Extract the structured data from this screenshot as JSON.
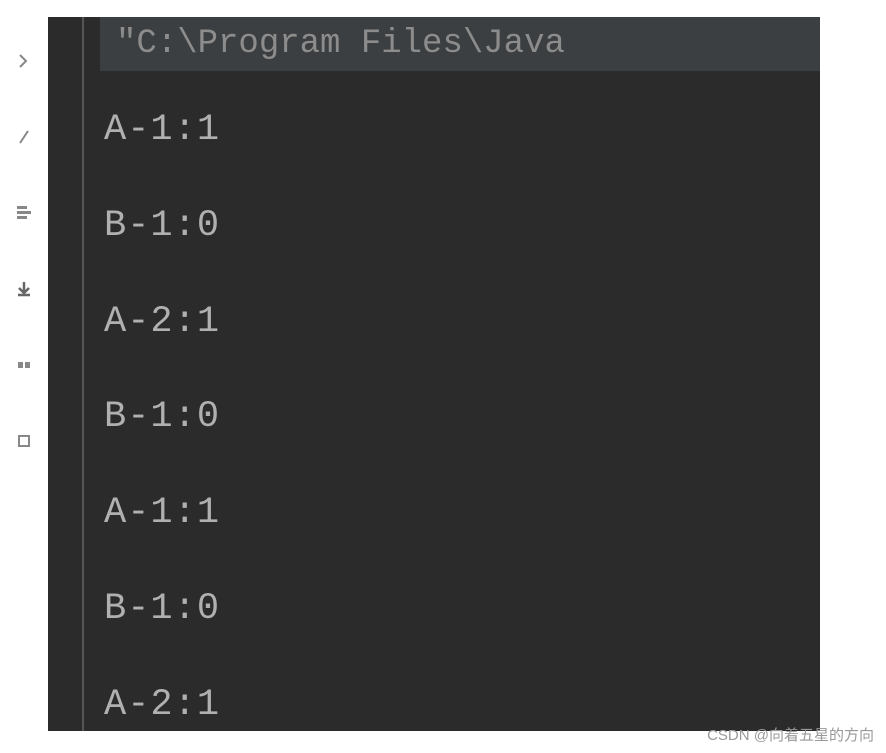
{
  "command": "\"C:\\Program Files\\Java",
  "output": [
    "A-1:1",
    "B-1:0",
    "A-2:1",
    "B-1:0",
    "A-1:1",
    "B-1:0",
    "A-2:1"
  ],
  "watermark": "CSDN @向着五星的方向",
  "sidebar_icons": [
    "chevron-icon",
    "play-icon",
    "settings-icon",
    "download-icon",
    "debug-icon",
    "more-icon"
  ]
}
